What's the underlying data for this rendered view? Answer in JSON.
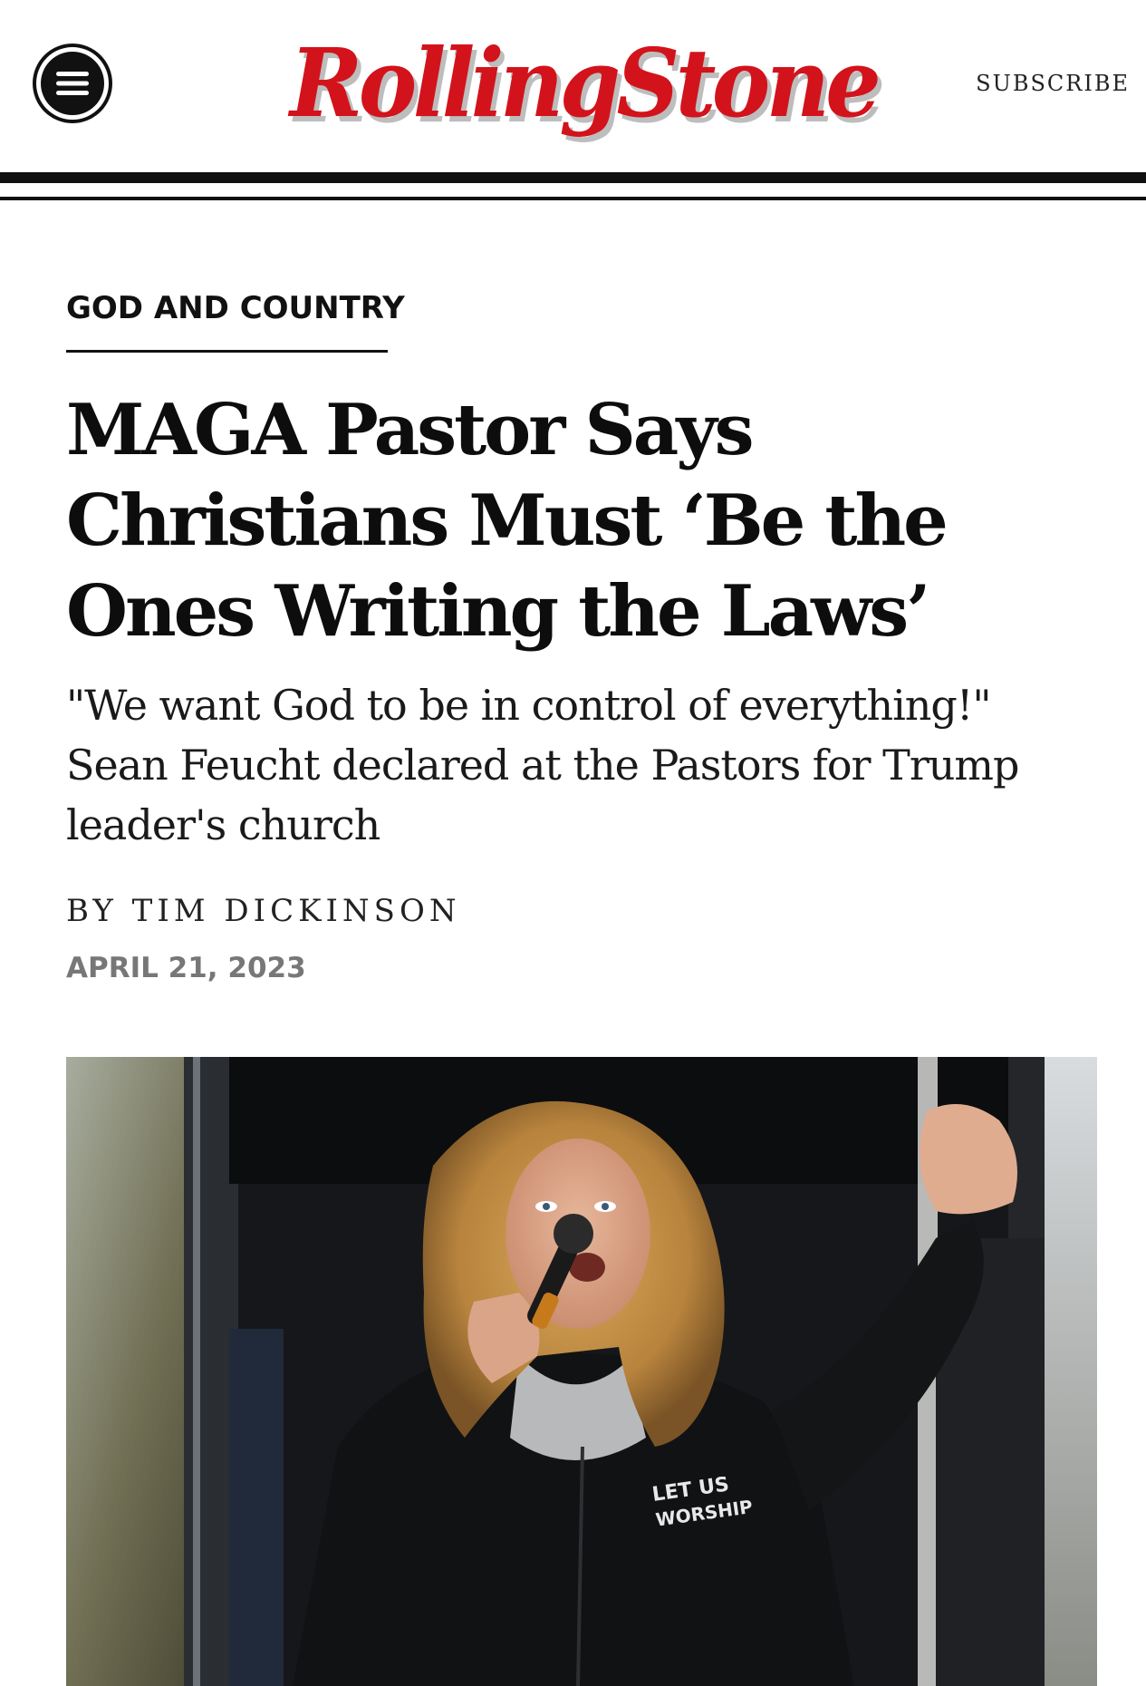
{
  "header": {
    "menu_icon": "hamburger-menu-icon",
    "logo_text": "RollingStone",
    "subscribe_label": "SUBSCRIBE",
    "brand_color": "#d3131b"
  },
  "article": {
    "kicker": "GOD AND COUNTRY",
    "headline": "MAGA Pastor Says Christians Must ‘Be the Ones Writing the Laws’",
    "dek": "\"We want God to be in control of everything!\" Sean Feucht declared at the Pastors for Trump leader's church",
    "byline_prefix": "BY",
    "author": "TIM DICKINSON",
    "date": "APRIL 21, 2023",
    "jacket_text": "LET US WORSHIP"
  }
}
